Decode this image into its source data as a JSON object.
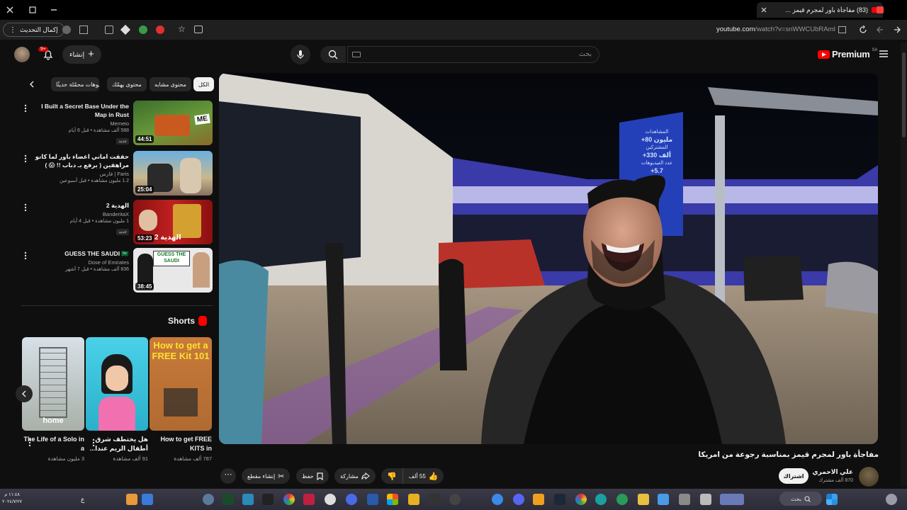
{
  "browser": {
    "tab_title": "(83) مفاجأة باور لمجرم قيمز ...",
    "url_host": "youtube.com",
    "url_path": "/watch?v=snWWCUbRAmI",
    "update_label": "إكمال التحديث",
    "new_tab_label": "+"
  },
  "header": {
    "brand": "Premium",
    "region": "SA",
    "search_placeholder": "بحث",
    "create_label": "إنشاء",
    "notif_count": "9+"
  },
  "chips": [
    {
      "label": "الكل",
      "active": true
    },
    {
      "label": "محتوى مشابه"
    },
    {
      "label": "محتوى يهمّك"
    },
    {
      "label": "فيديوهات محمّلة حديثًا"
    }
  ],
  "related": [
    {
      "title": "I Built a Secret Base Under the Map in Rust",
      "channel": "Memeio",
      "meta": "588 ألف مشاهدة • قبل 6 أيام",
      "badge": "جديد",
      "duration": "44:51"
    },
    {
      "title": "حققت اماني اعضاء باور لما كانو مراهقين ( برفع بـ دباب !! 😱 )",
      "channel": "Faris | فارس",
      "meta": "1.2 مليون مشاهدة • قبل أسبوعين",
      "badge": "",
      "duration": "25:04"
    },
    {
      "title": "الهدية 2",
      "channel": "BanderitaX",
      "meta": "1 مليون مشاهدة • قبل 4 أيام",
      "badge": "جديد",
      "duration": "53:23"
    },
    {
      "title": "GUESS THE SAUDI 🇸🇦",
      "channel": "Dose of Emirates",
      "meta": "836 ألف مشاهدة • قبل 7 أشهر",
      "badge": "",
      "duration": "38:45"
    }
  ],
  "thumb_texts": {
    "me": "ME",
    "gift": "الهدية 2",
    "guess": "GUESS THE SAUDI"
  },
  "shorts": {
    "title": "Shorts",
    "items": [
      {
        "title": "How to get FREE KITS in",
        "views": "787 ألف مشاهدة",
        "overlay": "How to get a FREE Kit 101"
      },
      {
        "title": "هل يختطف شرق أطفال الريم عندا...",
        "views": "91 ألف مشاهدة",
        "overlay": ""
      },
      {
        "title": "The Life of a Solo in a",
        "views": "3 مليون مشاهدة",
        "overlay": "home"
      }
    ]
  },
  "video": {
    "title": "مفاجأة باور لمجرم قيمز بمناسبة رجوعة من امريكا",
    "channel": "علي الاحمري",
    "subs": "870 ألف مشترك",
    "subscribe": "اشتراك",
    "likes": "55 ألف",
    "share": "مشاركة",
    "save": "حفظ",
    "clip": "إنشاء مقطع",
    "billboard_line1": "المشاهدات",
    "billboard_line2": "+80 مليون",
    "billboard_line3": "المشتركين",
    "billboard_line4": "+330 ألف",
    "billboard_line5": "عدد الفيديوهات",
    "billboard_line6": "+5.7"
  },
  "taskbar": {
    "time": "١١:٤٨ م",
    "date": "٢٠٢٤/٧/٢٧",
    "search": "بحث",
    "lang": "ع"
  },
  "colors": {
    "yt_red": "#ff0000",
    "bg": "#0f0f0f",
    "chip": "#272727"
  }
}
